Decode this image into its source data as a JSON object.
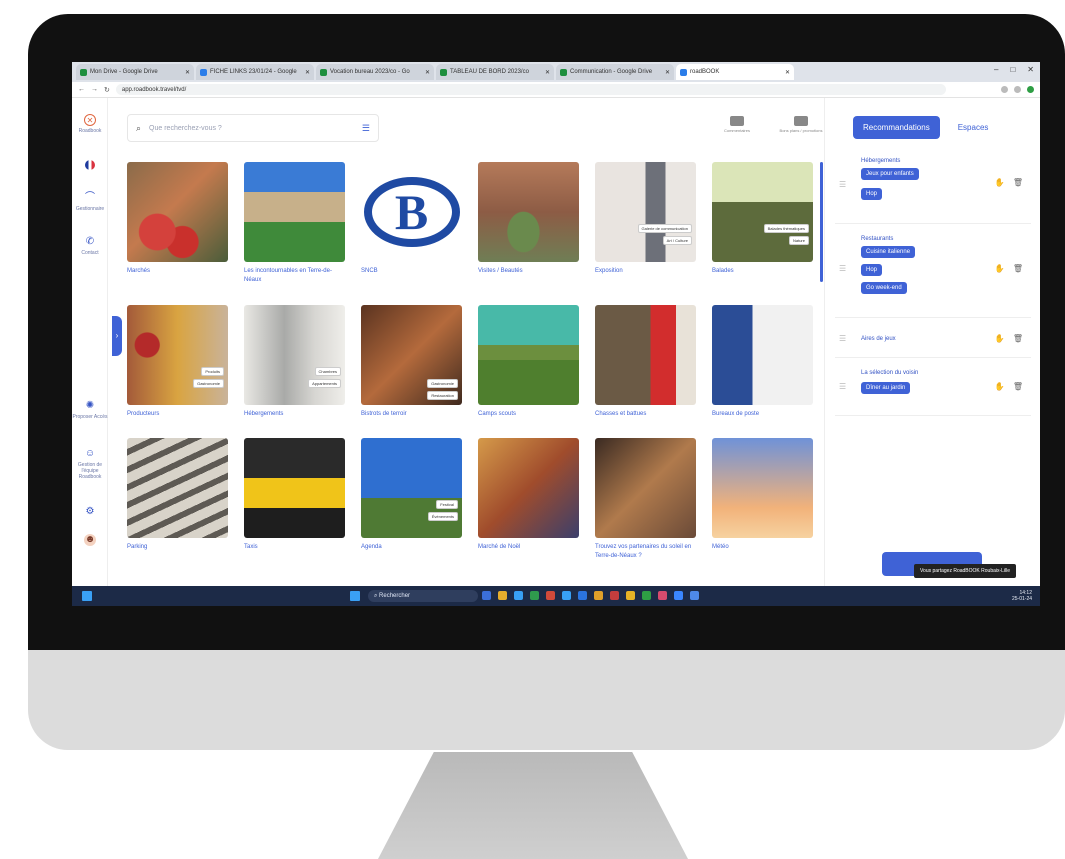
{
  "browser": {
    "tabs": [
      {
        "label": "Mon Drive - Google Drive",
        "active": false
      },
      {
        "label": "FICHE LINKS 23/01/24 - Google",
        "active": false
      },
      {
        "label": "Vocation bureau 2023/co - Go",
        "active": false
      },
      {
        "label": "TABLEAU DE BORD 2023/co",
        "active": false
      },
      {
        "label": "Communication - Google Drive",
        "active": false
      },
      {
        "label": "roadBOOK",
        "active": true
      }
    ],
    "url": "app.roadbook.travel/tvd/"
  },
  "rail": {
    "items": [
      {
        "name": "roadbook",
        "label": "Roadbook"
      },
      {
        "name": "language",
        "label": ""
      },
      {
        "name": "guests",
        "label": "Gestionnaire"
      },
      {
        "name": "contact",
        "label": "Contact"
      },
      {
        "name": "recommend",
        "label": "Proposer Accès"
      },
      {
        "name": "team",
        "label": "Gestion de l'équipe Roadbook"
      },
      {
        "name": "settings",
        "label": ""
      }
    ]
  },
  "search": {
    "placeholder": "Que recherchez-vous ?"
  },
  "top_actions": [
    {
      "label": "Commentaires"
    },
    {
      "label": "Bons plans / promotions"
    }
  ],
  "cards": [
    {
      "caption": "Marchés",
      "tags": []
    },
    {
      "caption": "Les incontournables en Terre-de-Néaux",
      "tags": []
    },
    {
      "caption": "SNCB",
      "tags": []
    },
    {
      "caption": "Visites / Beautés",
      "tags": []
    },
    {
      "caption": "Exposition",
      "tags": [
        "Galerie de communication",
        "Art / Culture"
      ]
    },
    {
      "caption": "Balades",
      "tags": [
        "Balades thématiques",
        "Nature"
      ]
    },
    {
      "caption": "Producteurs",
      "tags": [
        "Produits",
        "Gastronomie"
      ]
    },
    {
      "caption": "Hébergements",
      "tags": [
        "Chambres",
        "Appartements"
      ]
    },
    {
      "caption": "Bistrots de terroir",
      "tags": [
        "Gastronomie",
        "Restauration"
      ]
    },
    {
      "caption": "Camps scouts",
      "tags": []
    },
    {
      "caption": "Chasses et battues",
      "tags": []
    },
    {
      "caption": "Bureaux de poste",
      "tags": []
    },
    {
      "caption": "Parking",
      "tags": []
    },
    {
      "caption": "Taxis",
      "tags": []
    },
    {
      "caption": "Agenda",
      "tags": [
        "Festival",
        "Événements"
      ]
    },
    {
      "caption": "Marché de Noël",
      "tags": []
    },
    {
      "caption": "Trouvez vos partenaires du soleil en Terre-de-Néaux ?",
      "tags": []
    },
    {
      "caption": "Météo",
      "tags": []
    }
  ],
  "panel": {
    "tabs": {
      "active": "Recommandations",
      "other": "Espaces"
    },
    "groups": [
      {
        "title": "Hébergements",
        "chips": [
          "Jeux pour enfants",
          "Hop"
        ]
      },
      {
        "title": "Restaurants",
        "chips": [
          "Cuisine italienne",
          "Hop",
          "Go week-end"
        ]
      },
      {
        "title": "Aires de jeux",
        "chips": []
      },
      {
        "title": "La sélection du voisin",
        "chips": [
          "Dîner au jardin"
        ]
      }
    ],
    "tooltip": "Vous partagez RoadBOOK Roubaix-Lille"
  },
  "taskbar": {
    "search_label": "Rechercher",
    "clock_time": "14:12",
    "clock_date": "25-01-24",
    "app_colors": [
      "#3b6fd8",
      "#e4ad2d",
      "#38a0f5",
      "#2f9b4d",
      "#d14a3a",
      "#38a0f5",
      "#2b74e0",
      "#e0a02a",
      "#c43d3d",
      "#e6b226",
      "#2e9e44",
      "#d64b6e",
      "#3a86ff",
      "#4e89e8"
    ]
  }
}
